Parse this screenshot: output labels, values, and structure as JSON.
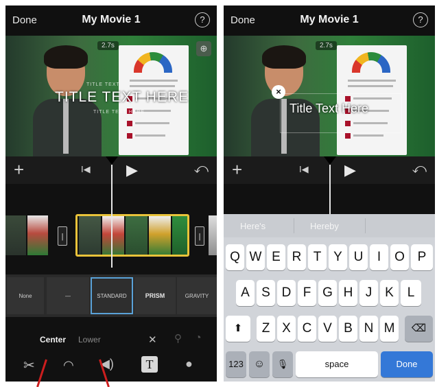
{
  "left": {
    "topbar": {
      "done": "Done",
      "title": "My Movie 1",
      "help": "?"
    },
    "video": {
      "time": "2.7s",
      "zoom": "⊕",
      "title_small_top": "TITLE TEXT",
      "title_big": "TITLE TEXT HERE",
      "title_small_bottom": "TITLE TEXT HERE"
    },
    "controls": {
      "add": "+",
      "prev": "I◀",
      "play": "▶",
      "undo": "⤺"
    },
    "timeline": {
      "handle_left": "|",
      "handle_right": "|"
    },
    "styles": [
      "None",
      "—",
      "STANDARD",
      "PRISM",
      "GRAVITY"
    ],
    "options": {
      "center": "Center",
      "lower": "Lower"
    }
  },
  "right": {
    "topbar": {
      "done": "Done",
      "title": "My Movie 1",
      "help": "?"
    },
    "video": {
      "time": "2.7s",
      "title_edit": "Title Text Here",
      "close": "×"
    },
    "controls": {
      "add": "+",
      "prev": "I◀",
      "play": "▶",
      "undo": "⤺"
    },
    "keyboard": {
      "suggestions": [
        "Here's",
        "Hereby",
        ""
      ],
      "row1": [
        "Q",
        "W",
        "E",
        "R",
        "T",
        "Y",
        "U",
        "I",
        "O",
        "P"
      ],
      "row2": [
        "A",
        "S",
        "D",
        "F",
        "G",
        "H",
        "J",
        "K",
        "L"
      ],
      "row3": [
        "Z",
        "X",
        "C",
        "V",
        "B",
        "N",
        "M"
      ],
      "shift": "⬆",
      "backspace": "⌫",
      "numbers": "123",
      "emoji": "☺",
      "mic": "🎙",
      "space": "space",
      "done": "Done"
    }
  },
  "colors": {
    "accent": "#e9c33a",
    "selection": "#5aa2d8",
    "done_key": "#3478d7",
    "annotation": "#cc1e1e"
  }
}
